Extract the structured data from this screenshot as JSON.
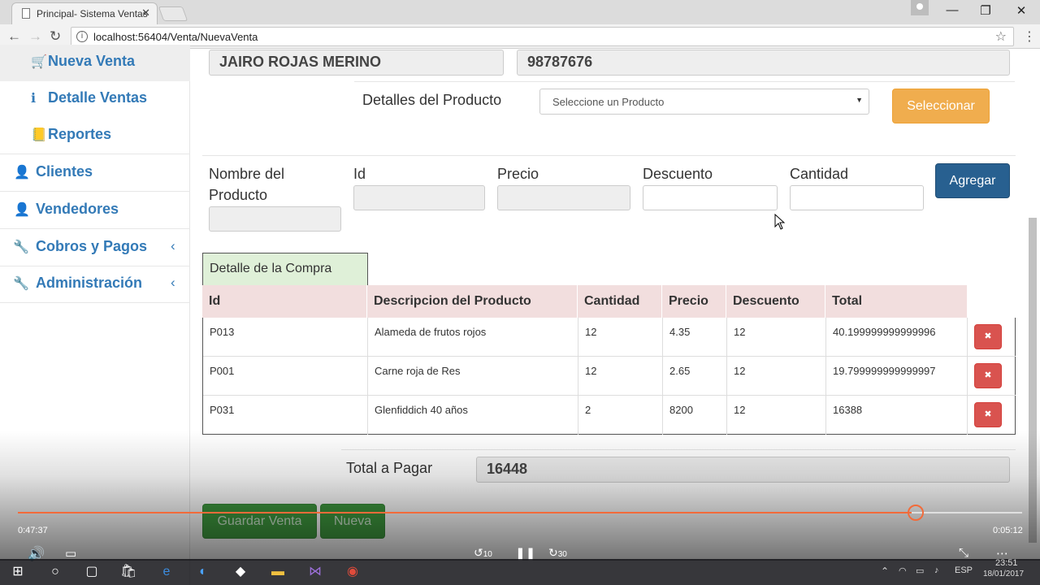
{
  "browser": {
    "tab_title": "Principal- Sistema Ventas",
    "url": "localhost:56404/Venta/NuevaVenta",
    "icons": [
      "back-icon",
      "forward-icon",
      "reload-icon",
      "info-icon",
      "star-icon",
      "menu-icon"
    ]
  },
  "sidebar": {
    "items": [
      {
        "label": "Nueva Venta",
        "icon": "cart-icon",
        "glyph": "🛒"
      },
      {
        "label": "Detalle Ventas",
        "icon": "info-icon",
        "glyph": "ℹ"
      },
      {
        "label": "Reportes",
        "icon": "book-icon",
        "glyph": "📒"
      },
      {
        "label": "Clientes",
        "icon": "user-icon",
        "glyph": "👤"
      },
      {
        "label": "Vendedores",
        "icon": "user-icon",
        "glyph": "👤"
      },
      {
        "label": "Cobros y Pagos",
        "icon": "wrench-icon",
        "glyph": "🔧"
      },
      {
        "label": "Administración",
        "icon": "wrench-icon",
        "glyph": "🔧"
      }
    ]
  },
  "client": {
    "name": "JAIRO ROJAS MERINO",
    "document": "98787676"
  },
  "product_select": {
    "label": "Detalles del Producto",
    "placeholder": "Seleccione un Producto",
    "button": "Seleccionar"
  },
  "product_form": {
    "name_label": "Nombre del Producto",
    "id_label": "Id",
    "price_label": "Precio",
    "discount_label": "Descuento",
    "qty_label": "Cantidad",
    "add_button": "Agregar"
  },
  "detail_table": {
    "caption": "Detalle de la Compra",
    "headers": [
      "Id",
      "Descripcion del Producto",
      "Cantidad",
      "Precio",
      "Descuento",
      "Total"
    ],
    "rows": [
      [
        "P013",
        "Alameda de frutos rojos",
        "12",
        "4.35",
        "12",
        "40.199999999999996"
      ],
      [
        "P001",
        "Carne roja de Res",
        "12",
        "2.65",
        "12",
        "19.799999999999997"
      ],
      [
        "P031",
        "Glenfiddich 40 años",
        "2",
        "8200",
        "12",
        "16388"
      ]
    ],
    "delete_glyph": "✖"
  },
  "total": {
    "label": "Total a Pagar",
    "value": "16448"
  },
  "actions": {
    "save": "Guardar Venta",
    "new": "Nueva"
  },
  "video": {
    "elapsed": "0:47:37",
    "remaining": "0:05:12",
    "progress": 0.89,
    "skip_back": "10",
    "skip_forward": "30",
    "accent": "#f26b3a"
  },
  "taskbar": {
    "lang": "ESP",
    "time": "23:51",
    "date": "18/01/2017"
  }
}
